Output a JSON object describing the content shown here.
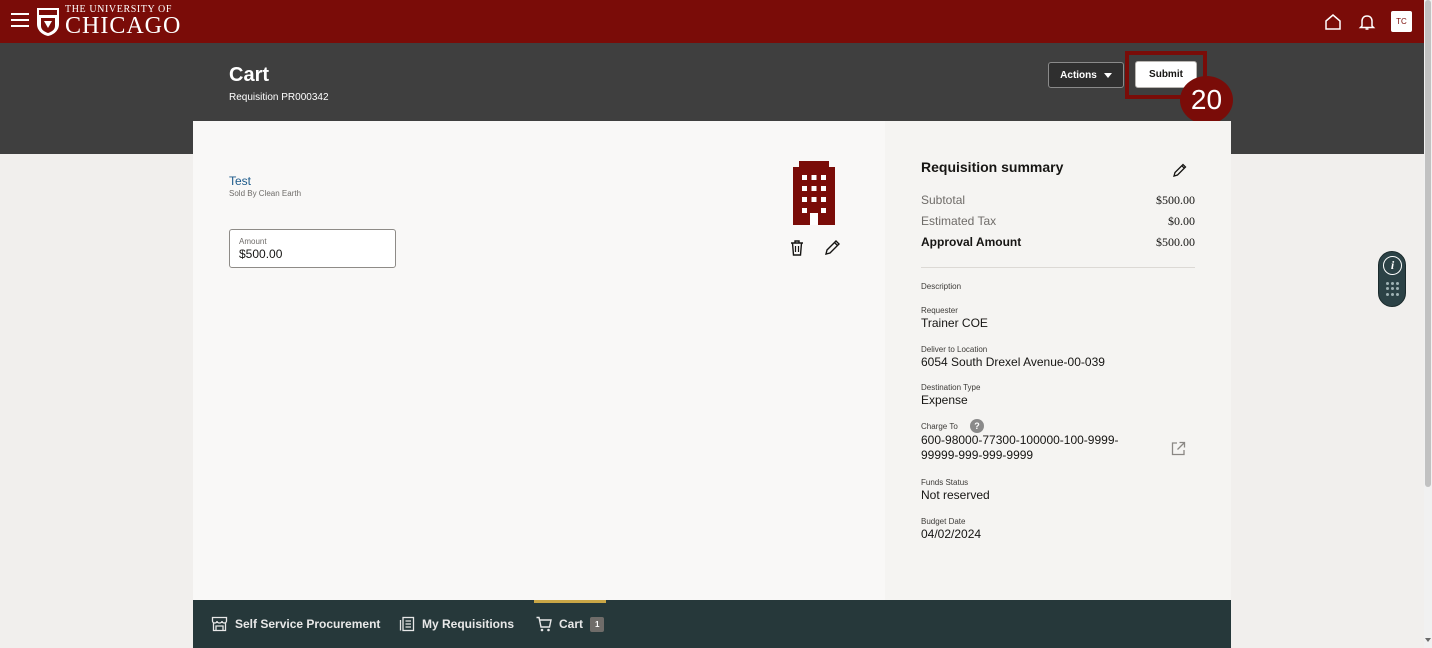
{
  "header": {
    "logo_small": "THE UNIVERSITY OF",
    "logo_big": "CHICAGO",
    "avatar": "TC",
    "brand_color": "#7a0c08"
  },
  "page": {
    "title": "Cart",
    "subtitle": "Requisition PR000342",
    "actions_label": "Actions",
    "submit_label": "Submit",
    "step_badge": "20"
  },
  "cart_item": {
    "name": "Test",
    "seller": "Sold By Clean Earth",
    "amount_label": "Amount",
    "amount_value": "$500.00",
    "icon": "building-icon"
  },
  "summary": {
    "title": "Requisition summary",
    "rows": [
      {
        "label": "Subtotal",
        "value": "$500.00"
      },
      {
        "label": "Estimated Tax",
        "value": "$0.00"
      },
      {
        "label": "Approval Amount",
        "value": "$500.00"
      }
    ],
    "description_label": "Description",
    "requester_label": "Requester",
    "requester_value": "Trainer COE",
    "deliver_label": "Deliver to Location",
    "deliver_value": "6054 South Drexel Avenue-00-039",
    "destination_label": "Destination Type",
    "destination_value": "Expense",
    "charge_label": "Charge To",
    "charge_value_line1": "600-98000-77300-100000-100-9999-",
    "charge_value_line2": "99999-999-999-9999",
    "funds_label": "Funds Status",
    "funds_value": "Not reserved",
    "budget_label": "Budget Date",
    "budget_value": "04/02/2024"
  },
  "tabs": [
    {
      "label": "Self Service Procurement",
      "icon": "store-icon"
    },
    {
      "label": "My Requisitions",
      "icon": "requisitions-icon"
    },
    {
      "label": "Cart",
      "icon": "cart-icon",
      "badge": "1",
      "active": true
    }
  ]
}
